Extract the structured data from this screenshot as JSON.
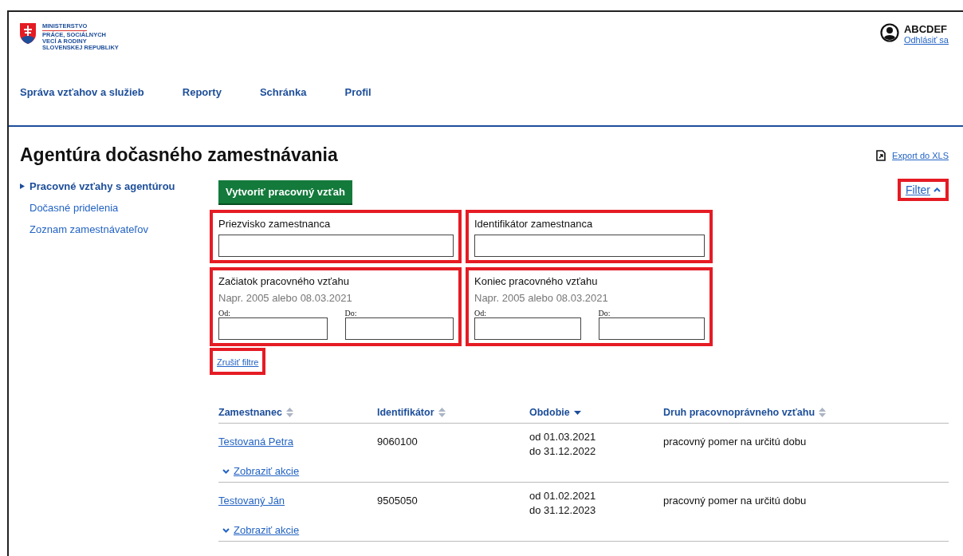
{
  "header": {
    "logo_lines": [
      "MINISTERSTVO",
      "PRÁCE, SOCIÁLNYCH",
      "VECÍ A RODINY",
      "SLOVENSKEJ REPUBLIKY"
    ],
    "user": {
      "name": "ABCDEF",
      "logout": "Odhlásiť sa"
    }
  },
  "nav": [
    {
      "label": "Správa vzťahov a služieb"
    },
    {
      "label": "Reporty"
    },
    {
      "label": "Schránka"
    },
    {
      "label": "Profil"
    }
  ],
  "page": {
    "title": "Agentúra dočasného zamestnávania",
    "export": "Export do XLS"
  },
  "sidebar": {
    "items": [
      {
        "label": "Pracovné vzťahy s agentúrou",
        "selected": true
      },
      {
        "label": "Dočasné pridelenia",
        "selected": false
      },
      {
        "label": "Zoznam zamestnávateľov",
        "selected": false
      }
    ]
  },
  "create_button": "Vytvoriť pracovný vzťah",
  "filter": {
    "toggle": {
      "label": "Filter",
      "expanded": true,
      "highlighted": true
    },
    "groups": [
      {
        "kind": "text",
        "label": "Priezvisko zamestnanca",
        "highlighted": true
      },
      {
        "kind": "text",
        "label": "Identifikátor zamestnanca",
        "highlighted": true
      },
      {
        "kind": "range",
        "label": "Začiatok pracovného vzťahu",
        "hint": "Napr. 2005 alebo 08.03.2021",
        "from_label": "Od:",
        "to_label": "Do:",
        "highlighted": true
      },
      {
        "kind": "range",
        "label": "Koniec pracovného vzťahu",
        "hint": "Napr. 2005 alebo 08.03.2021",
        "from_label": "Od:",
        "to_label": "Do:",
        "highlighted": true
      }
    ],
    "clear": {
      "label": "Zrušiť filtre",
      "highlighted": true
    }
  },
  "table": {
    "columns": [
      {
        "label": "Zamestnanec",
        "sorted": false
      },
      {
        "label": "Identifikátor",
        "sorted": false
      },
      {
        "label": "Obdobie",
        "sorted": true
      },
      {
        "label": "Druh pracovnoprávneho vzťahu",
        "sorted": false
      }
    ],
    "rows": [
      {
        "employee": "Testovaná Petra",
        "id": "9060100",
        "period": [
          "od 01.03.2021",
          "do 31.12.2022"
        ],
        "type": "pracovný pomer na určitú dobu",
        "actions": "Zobraziť akcie"
      },
      {
        "employee": "Testovaný Ján",
        "id": "9505050",
        "period": [
          "od 01.02.2021",
          "do 31.12.2023"
        ],
        "type": "pracovný pomer na určitú dobu",
        "actions": "Zobraziť akcie"
      }
    ]
  }
}
